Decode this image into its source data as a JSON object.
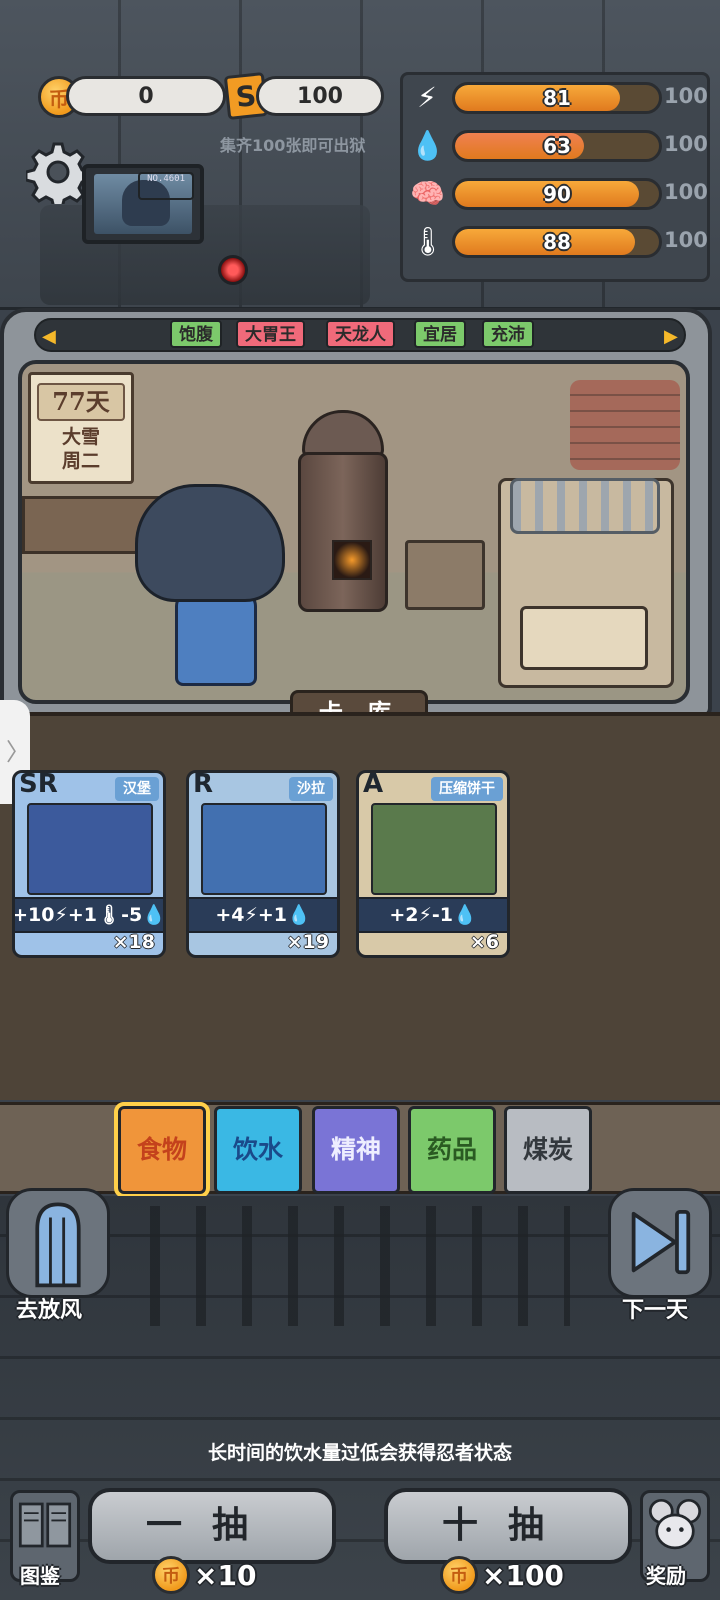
{
  "currency": {
    "coins": "0",
    "coin_icon": "币",
    "tickets": "100",
    "ticket_icon": "S",
    "hint": "集齐100张即可出狱"
  },
  "stats": [
    {
      "name": "energy",
      "icon": "lightning-icon",
      "glyph": "⚡",
      "value": "81",
      "max": "100",
      "fraction": 0.81,
      "color": "#f7a93a"
    },
    {
      "name": "water",
      "icon": "water-drop-icon",
      "glyph": "💧",
      "value": "63",
      "max": "100",
      "fraction": 0.63,
      "color": "#f08050"
    },
    {
      "name": "mind",
      "icon": "brain-icon",
      "glyph": "🧠",
      "value": "90",
      "max": "100",
      "fraction": 0.9,
      "color": "#f7a93a"
    },
    {
      "name": "temperature",
      "icon": "thermometer-icon",
      "glyph": "🌡",
      "value": "88",
      "max": "100",
      "fraction": 0.88,
      "color": "#f7a93a"
    }
  ],
  "monitor": {
    "tag": "NO.4601"
  },
  "status_tags": [
    {
      "label": "饱腹",
      "color": "#7cc96b"
    },
    {
      "label": "大胃王",
      "color": "#f06a7a"
    },
    {
      "label": "天龙人",
      "color": "#f06a7a"
    },
    {
      "label": "宜居",
      "color": "#7cc96b"
    },
    {
      "label": "充沛",
      "color": "#7cc96b"
    }
  ],
  "calendar": {
    "days": "77天",
    "weather": "大雪",
    "weekday": "周二"
  },
  "card_library_label": "卡 库",
  "cards": [
    {
      "rank": "SR",
      "name": "汉堡",
      "effect": "+10⚡+1🌡-5💧",
      "count": "×18",
      "bg": "#9fc2e8",
      "art": "#3c5a9c"
    },
    {
      "rank": "R",
      "name": "沙拉",
      "effect": "+4⚡+1💧",
      "count": "×19",
      "bg": "#a8c6e2",
      "art": "#4270b0"
    },
    {
      "rank": "A",
      "name": "压缩饼干",
      "effect": "+2⚡-1💧",
      "count": "×6",
      "bg": "#d8c9a8",
      "art": "#5a7a4c"
    }
  ],
  "categories": [
    {
      "label": "食物",
      "color": "#f0953a",
      "text": "#c4421c",
      "selected": true
    },
    {
      "label": "饮水",
      "color": "#3ab8e4",
      "text": "#1a4a8a",
      "selected": false
    },
    {
      "label": "精神",
      "color": "#7a74d6",
      "text": "#eef",
      "selected": false
    },
    {
      "label": "药品",
      "color": "#7cc96b",
      "text": "#2a5a22",
      "selected": false
    },
    {
      "label": "煤炭",
      "color": "#b8bcc2",
      "text": "#33383d",
      "selected": false
    }
  ],
  "actions": {
    "yard_label": "去放风",
    "next_day_label": "下一天",
    "tip": "长时间的饮水量过低会获得忍者状态",
    "draw_one_label": "一抽",
    "draw_one_cost": "×10",
    "draw_ten_label": "十抽",
    "draw_ten_cost": "×100",
    "catalog_label": "图鉴",
    "reward_label": "奖励"
  }
}
